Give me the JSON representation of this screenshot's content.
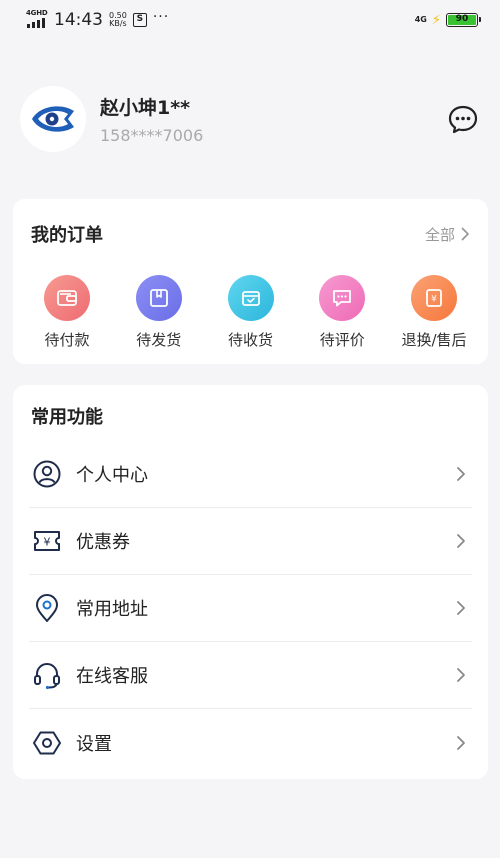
{
  "status_bar": {
    "network_type": "4GHD",
    "time": "14:43",
    "speed_value": "0.50",
    "speed_unit": "KB/s",
    "s_icon": "S",
    "more": "···",
    "net_right": "4G",
    "battery": "90"
  },
  "profile": {
    "name": "赵小坤1**",
    "phone": "158****7006",
    "avatar_icon": "fish-eye-logo-icon",
    "message_icon": "chat-bubble-icon"
  },
  "orders": {
    "title": "我的订单",
    "all_label": "全部",
    "items": [
      {
        "label": "待付款",
        "icon": "wallet-icon",
        "color": "#f07a78"
      },
      {
        "label": "待发货",
        "icon": "package-icon",
        "color": "#7b7df0"
      },
      {
        "label": "待收货",
        "icon": "receive-box-icon",
        "color": "#3fc6e6"
      },
      {
        "label": "待评价",
        "icon": "comment-icon",
        "color": "#f47fc2"
      },
      {
        "label": "退换/售后",
        "icon": "refund-icon",
        "color": "#f98a4e"
      }
    ]
  },
  "functions": {
    "title": "常用功能",
    "items": [
      {
        "label": "个人中心",
        "icon": "user-circle-icon"
      },
      {
        "label": "优惠券",
        "icon": "coupon-icon"
      },
      {
        "label": "常用地址",
        "icon": "location-pin-icon"
      },
      {
        "label": "在线客服",
        "icon": "headset-icon"
      },
      {
        "label": "设置",
        "icon": "settings-hexagon-icon"
      }
    ]
  },
  "colors": {
    "accent_blue": "#1e3f8c",
    "icon_dark": "#1f2d4d",
    "background": "#f5f5f7"
  }
}
